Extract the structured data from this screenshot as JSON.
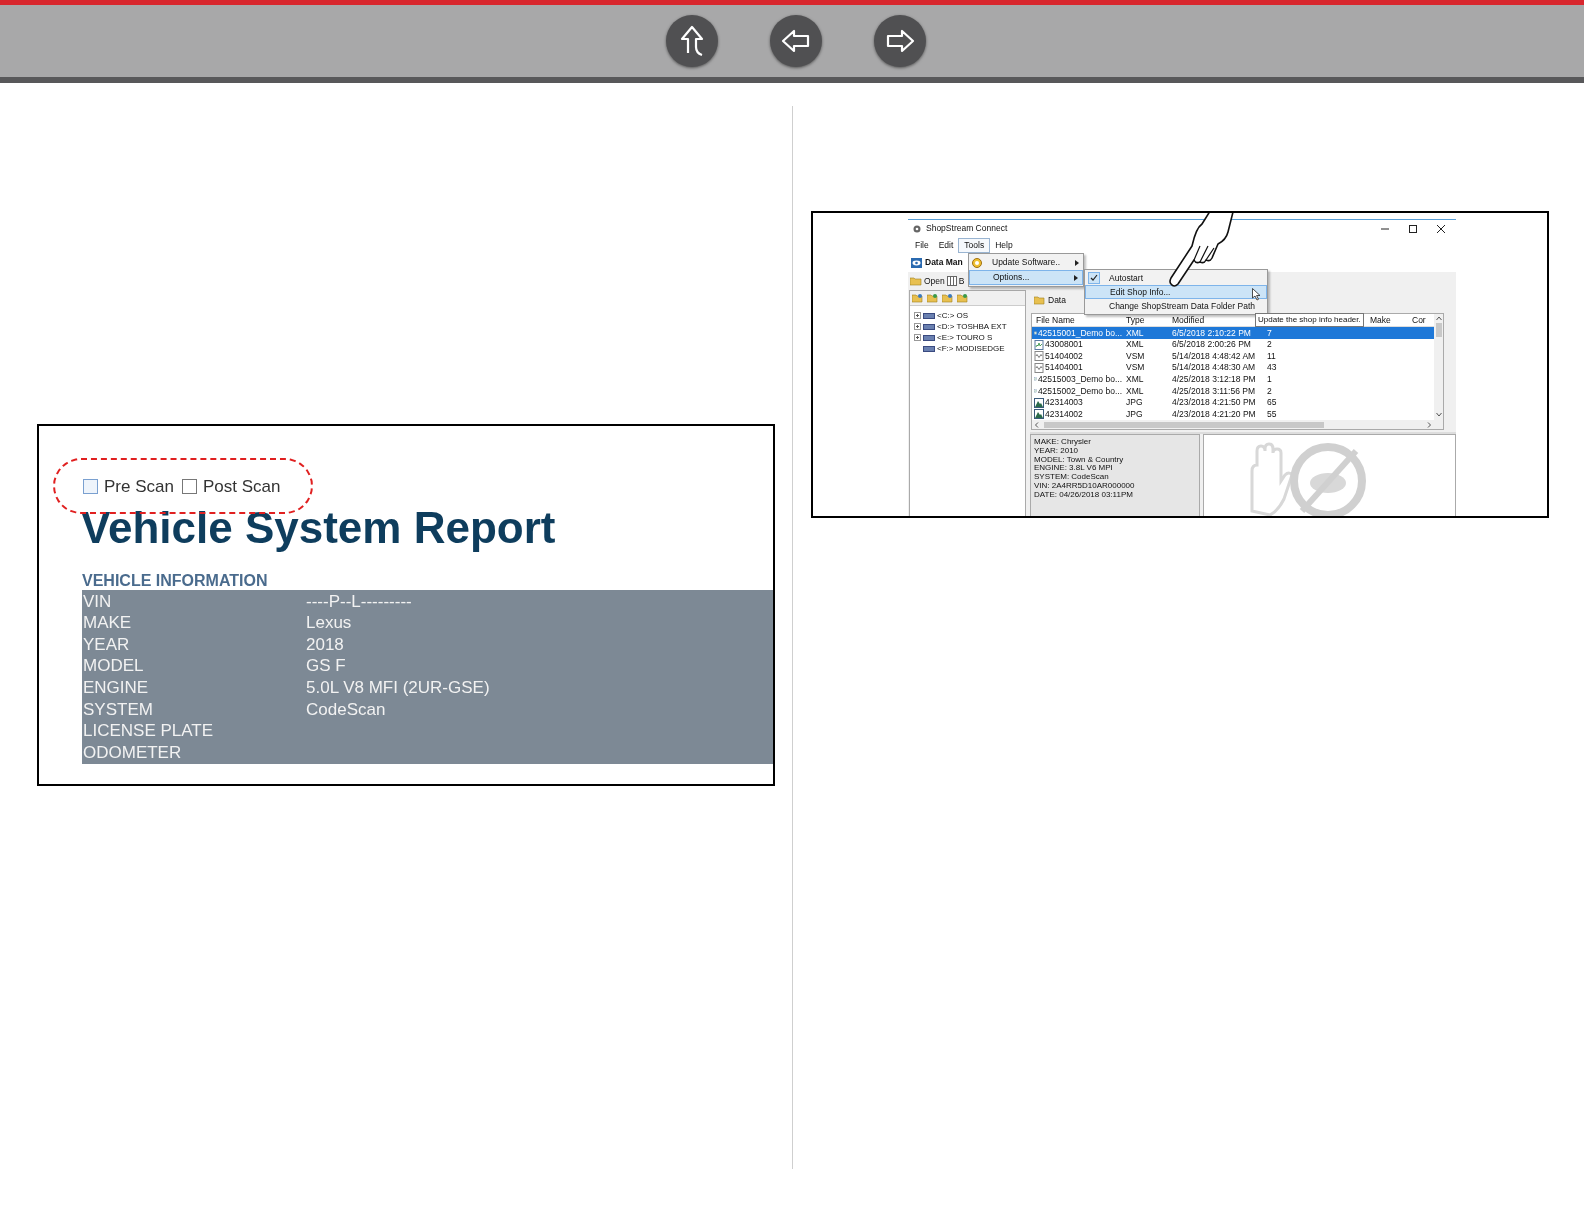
{
  "nav_buttons": [
    {
      "kind": "up"
    },
    {
      "kind": "back"
    },
    {
      "kind": "forward"
    }
  ],
  "report_figure": {
    "checkboxes": [
      {
        "label": "Pre Scan",
        "checked": false,
        "focused": true
      },
      {
        "label": "Post Scan",
        "checked": false,
        "focused": false
      }
    ],
    "title": "Vehicle System Report",
    "section_heading": "VEHICLE INFORMATION",
    "rows": [
      {
        "label": "VIN",
        "value": "----P--L---------"
      },
      {
        "label": "MAKE",
        "value": "Lexus"
      },
      {
        "label": "YEAR",
        "value": "2018"
      },
      {
        "label": "MODEL",
        "value": "GS F"
      },
      {
        "label": "ENGINE",
        "value": "5.0L V8 MFI (2UR-GSE)"
      },
      {
        "label": "SYSTEM",
        "value": "CodeScan"
      },
      {
        "label": "LICENSE PLATE"
      },
      {
        "label": "ODOMETER"
      }
    ]
  },
  "app_window": {
    "title": "ShopStream Connect",
    "menu": [
      {
        "label": "File",
        "selected": false
      },
      {
        "label": "Edit",
        "selected": false
      },
      {
        "label": "Tools",
        "selected": true
      },
      {
        "label": "Help",
        "selected": false
      }
    ],
    "toolbar_label": "Data Man",
    "toolbar_buttons": [
      "Open",
      "B"
    ],
    "tools_menu": [
      {
        "label": "Update Software..",
        "selected": false
      },
      {
        "label": "Options...",
        "selected": true
      }
    ],
    "options_submenu": [
      {
        "label": "Autostart",
        "checked": true,
        "selected": false
      },
      {
        "label": "Edit Shop Info...",
        "checked": false,
        "selected": true
      },
      {
        "label": "Change ShopStream Data Folder Path",
        "checked": false,
        "selected": false
      }
    ],
    "tree": [
      {
        "label": "<C:> OS",
        "expandable": true
      },
      {
        "label": "<D:> TOSHBA EXT",
        "expandable": true
      },
      {
        "label": "<E:> TOURO S",
        "expandable": true
      },
      {
        "label": "<F:> MODISEDGE",
        "expandable": false
      }
    ],
    "tab": "Data",
    "columns": [
      "File Name",
      "Type",
      "Modified",
      "Make",
      "Cor"
    ],
    "tooltip": "Update the shop info header.",
    "rows": [
      {
        "kind": "doc",
        "file_name": "42515001_Demo bo...",
        "type": "XML",
        "modified": "6/5/2018 2:10:22 PM",
        "column_4": "7",
        "selected": true
      },
      {
        "kind": "doc",
        "file_name": "43008001",
        "type": "XML",
        "modified": "6/5/2018 2:00:26 PM",
        "column_4": "2",
        "selected": false
      },
      {
        "kind": "wave",
        "file_name": "51404002",
        "type": "VSM",
        "modified": "5/14/2018 4:48:42 AM",
        "column_4": "11",
        "selected": false
      },
      {
        "kind": "wave",
        "file_name": "51404001",
        "type": "VSM",
        "modified": "5/14/2018 4:48:30 AM",
        "column_4": "43",
        "selected": false
      },
      {
        "kind": "doc",
        "file_name": "42515003_Demo bo...",
        "type": "XML",
        "modified": "4/25/2018 3:12:18 PM",
        "column_4": "1",
        "selected": false
      },
      {
        "kind": "doc",
        "file_name": "42515002_Demo bo...",
        "type": "XML",
        "modified": "4/25/2018 3:11:56 PM",
        "column_4": "2",
        "selected": false
      },
      {
        "kind": "image",
        "file_name": "42314003",
        "type": "JPG",
        "modified": "4/23/2018 4:21:50 PM",
        "column_4": "65",
        "selected": false
      },
      {
        "kind": "image",
        "file_name": "42314002",
        "type": "JPG",
        "modified": "4/23/2018 4:21:20 PM",
        "column_4": "55",
        "selected": false
      }
    ],
    "info_lines": [
      "MAKE: Chrysler",
      "YEAR: 2010",
      "MODEL: Town & Country",
      "ENGINE: 3.8L V6 MPI",
      "SYSTEM: CodeScan",
      "VIN: 2A4RR5D10AR000000",
      "DATE: 04/26/2018  03:11PM"
    ]
  }
}
